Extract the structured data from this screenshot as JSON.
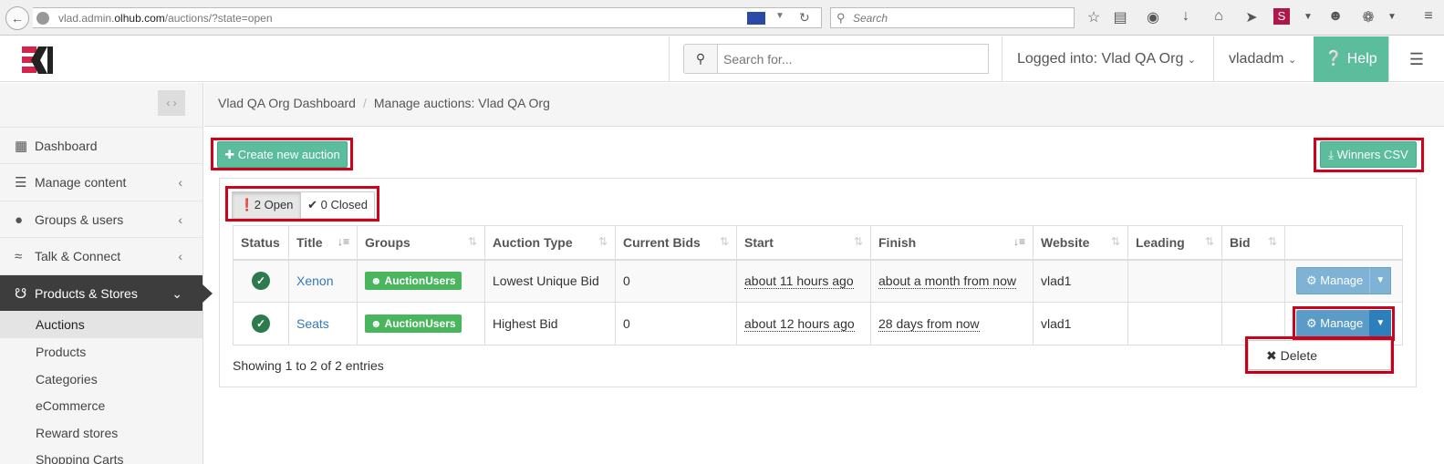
{
  "browser": {
    "url_prefix": "vlad.admin.",
    "url_domain": "olhub.com",
    "url_path": "/auctions/?state=open",
    "search_placeholder": "Search"
  },
  "header": {
    "search_placeholder": "Search for...",
    "org_label": "Logged into: Vlad QA Org",
    "user_label": "vladadm",
    "help_label": "Help"
  },
  "sidebar": {
    "items": [
      {
        "label": "Dashboard",
        "icon": "dashboard-icon"
      },
      {
        "label": "Manage content",
        "icon": "layers-icon"
      },
      {
        "label": "Groups & users",
        "icon": "user-icon"
      },
      {
        "label": "Talk & Connect",
        "icon": "wifi-icon"
      },
      {
        "label": "Products & Stores",
        "icon": "cart-icon"
      }
    ],
    "sub_items": [
      "Auctions",
      "Products",
      "Categories",
      "eCommerce",
      "Reward stores",
      "Shopping Carts"
    ]
  },
  "breadcrumb": {
    "first": "Vlad QA Org Dashboard",
    "second": "Manage auctions: Vlad QA Org"
  },
  "actions": {
    "create_label": "Create new auction",
    "winners_label": "Winners CSV"
  },
  "tabs": {
    "open": "2 Open",
    "closed": "0 Closed"
  },
  "table": {
    "columns": [
      "Status",
      "Title",
      "Groups",
      "Auction Type",
      "Current Bids",
      "Start",
      "Finish",
      "Website",
      "Leading",
      "Bid"
    ],
    "rows": [
      {
        "title": "Xenon",
        "group": "AuctionUsers",
        "type": "Lowest Unique Bid",
        "bids": "0",
        "start": "about 11 hours ago",
        "finish": "about a month from now",
        "website": "vlad1",
        "leading": "",
        "bid": ""
      },
      {
        "title": "Seats",
        "group": "AuctionUsers",
        "type": "Highest Bid",
        "bids": "0",
        "start": "about 12 hours ago",
        "finish": "28 days from now",
        "website": "vlad1",
        "leading": "",
        "bid": ""
      }
    ],
    "manage_label": "Manage",
    "info": "Showing 1 to 2 of 2 entries"
  },
  "dropdown": {
    "delete_label": "Delete"
  },
  "colors": {
    "accent_green": "#5cbd9d",
    "manage_blue": "#7fb3d5",
    "highlight_red": "#d0021b",
    "sidebar_active": "#3d3d3d"
  }
}
